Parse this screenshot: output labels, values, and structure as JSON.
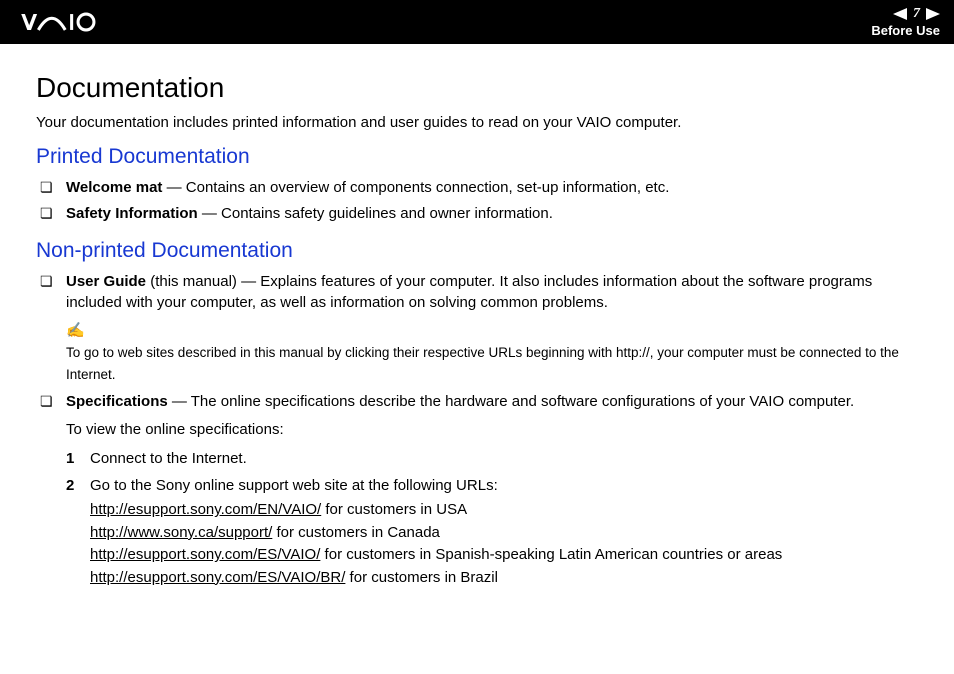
{
  "header": {
    "page_number": "7",
    "section_label": "Before Use"
  },
  "title": "Documentation",
  "intro": "Your documentation includes printed information and user guides to read on your VAIO computer.",
  "printed": {
    "heading": "Printed Documentation",
    "items": [
      {
        "term": "Welcome mat",
        "desc": " — Contains an overview of components connection, set-up information, etc."
      },
      {
        "term": "Safety Information",
        "desc": " — Contains safety guidelines and owner information."
      }
    ]
  },
  "nonprinted": {
    "heading": "Non-printed Documentation",
    "user_guide_term": "User Guide",
    "user_guide_desc": " (this manual) — Explains features of your computer. It also includes information about the software programs included with your computer, as well as information on solving common problems.",
    "note_icon": "✍",
    "note_text": "To go to web sites described in this manual by clicking their respective URLs beginning with http://, your computer must be connected to the Internet.",
    "specs_term": "Specifications",
    "specs_desc": " — The online specifications describe the hardware and software configurations of your VAIO computer.",
    "specs_sub": "To view the online specifications:",
    "steps": {
      "s1_num": "1",
      "s1_text": "Connect to the Internet.",
      "s2_num": "2",
      "s2_text": "Go to the Sony online support web site at the following URLs:",
      "urls": [
        {
          "link": "http://esupport.sony.com/EN/VAIO/",
          "suffix": " for customers in USA"
        },
        {
          "link": "http://www.sony.ca/support/",
          "suffix": " for customers in Canada"
        },
        {
          "link": "http://esupport.sony.com/ES/VAIO/",
          "suffix": " for customers in Spanish-speaking Latin American countries or areas"
        },
        {
          "link": "http://esupport.sony.com/ES/VAIO/BR/",
          "suffix": " for customers in Brazil"
        }
      ]
    }
  }
}
